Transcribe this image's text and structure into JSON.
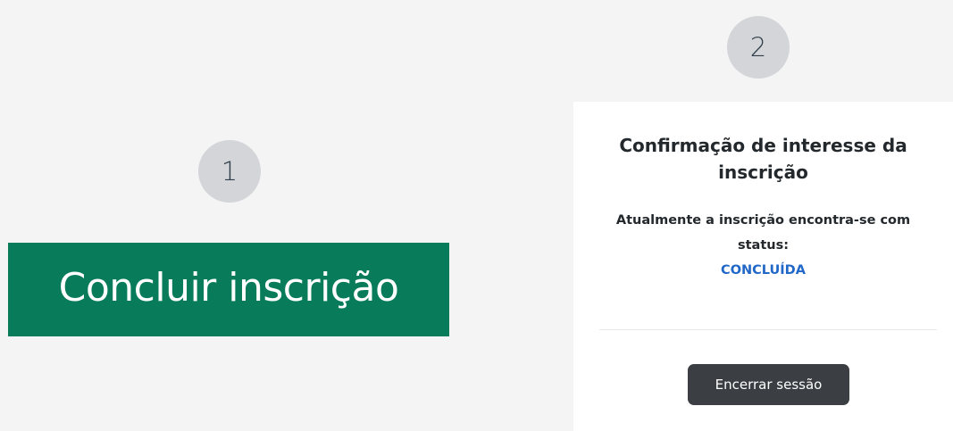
{
  "steps": {
    "step1": "1",
    "step2": "2"
  },
  "left_panel": {
    "conclude_button_label": "Concluir inscrição",
    "button_color": "#087c5a"
  },
  "confirmation_card": {
    "title": "Confirmação de interesse da inscrição",
    "status_text": "Atualmente a inscrição encontra-se com status:",
    "status_value": "CONCLUÍDA",
    "status_color": "#2167c8",
    "logout_button_label": "Encerrar sessão"
  }
}
